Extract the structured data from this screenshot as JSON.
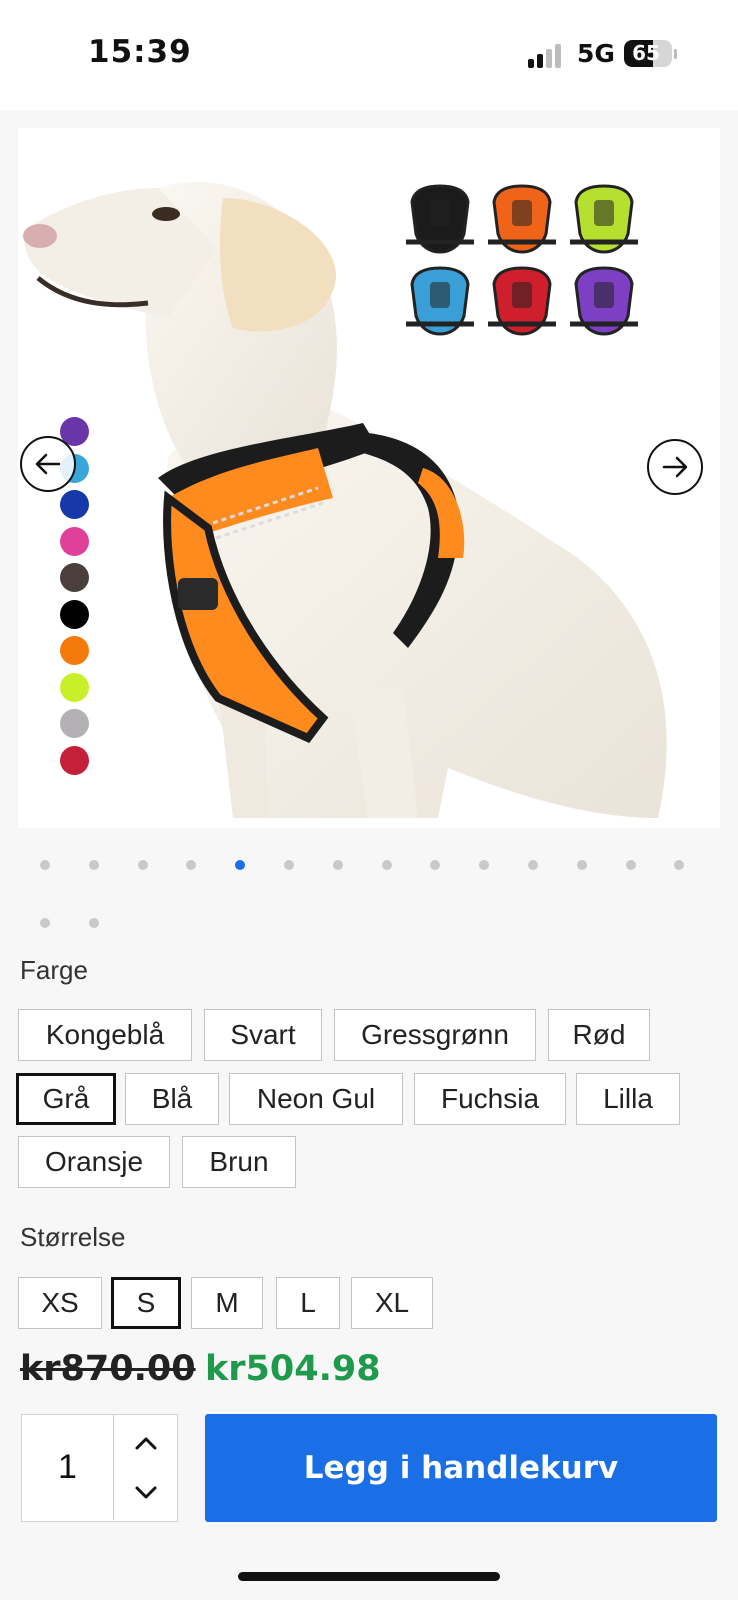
{
  "status_bar": {
    "time": "15:39",
    "network": "5G",
    "battery_percent": "65",
    "battery_level": 0.65
  },
  "gallery": {
    "prev_icon": "arrow-left-icon",
    "next_icon": "arrow-right-icon",
    "dot_count": 16,
    "active_index": 4,
    "swatch_colors": [
      "#6a35a8",
      "#3aa6d8",
      "#1638a8",
      "#e0409a",
      "#4a3f3c",
      "#000000",
      "#f57a0c",
      "#c8f02a",
      "#b3b1b3",
      "#c4203a"
    ],
    "harness_colors": [
      "#1b1b1b",
      "#f0641a",
      "#b6e030",
      "#3a9fd6",
      "#d01f2c",
      "#7d3fc4"
    ]
  },
  "color_option": {
    "label": "Farge",
    "options": [
      "Kongeblå",
      "Svart",
      "Gressgrønn",
      "Rød",
      "Grå",
      "Blå",
      "Neon Gul",
      "Fuchsia",
      "Lilla",
      "Oransje",
      "Brun"
    ],
    "selected": "Grå"
  },
  "size_option": {
    "label": "Størrelse",
    "options": [
      "XS",
      "S",
      "M",
      "L",
      "XL"
    ],
    "selected": "S"
  },
  "price": {
    "original": "kr870.00",
    "sale": "kr504.98",
    "sale_color": "#1f9a4c"
  },
  "cart": {
    "quantity": "1",
    "add_label": "Legg i handlekurv",
    "button_color": "#1a6fe6",
    "up_icon": "chevron-up-icon",
    "down_icon": "chevron-down-icon"
  }
}
